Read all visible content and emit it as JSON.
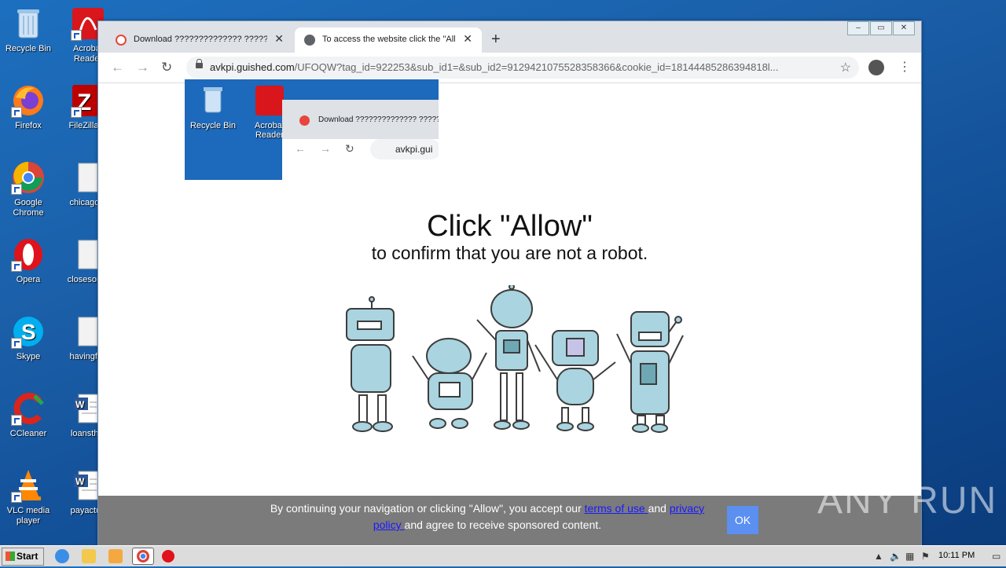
{
  "desktop": {
    "icons": [
      {
        "label": "Recycle Bin"
      },
      {
        "label": "Acrobat Reader"
      },
      {
        "label": "Firefox"
      },
      {
        "label": "FileZilla C"
      },
      {
        "label": "Google Chrome"
      },
      {
        "label": "chicagoto"
      },
      {
        "label": "Opera"
      },
      {
        "label": "closesome"
      },
      {
        "label": "Skype"
      },
      {
        "label": "havingfitn"
      },
      {
        "label": "CCleaner"
      },
      {
        "label": "loansthin"
      },
      {
        "label": "VLC media player"
      },
      {
        "label": "payactua"
      }
    ]
  },
  "browser": {
    "tabs": [
      {
        "title": "Download ?????????????? ??????? ???",
        "active": false
      },
      {
        "title": "To access the website click the \"Allow\"",
        "active": true
      }
    ],
    "url_host": "avkpi.guished.com",
    "url_path": "/UFOQW?tag_id=922253&sub_id1=&sub_id2=9129421075528358366&cookie_id=18144485286394818l...",
    "embedded_screenshot": {
      "icons": [
        "Recycle Bin",
        "Acrobat Reader"
      ],
      "tab_title": "Download ?????????????? ??????",
      "url": "avkpi.gui"
    }
  },
  "page": {
    "headline": "Click \"Allow\"",
    "subheadline": "to confirm that you are not a robot.",
    "cookie": {
      "text_before": "By continuing your navigation or clicking \"Allow\", you accept our ",
      "terms_link": "terms of use ",
      "text_mid": "and ",
      "privacy_link": "privacy policy ",
      "text_after": "and agree to receive sponsored content.",
      "ok_label": "OK"
    }
  },
  "watermark": "ANY RUN",
  "taskbar": {
    "start_label": "Start",
    "clock": "10:11 PM"
  }
}
